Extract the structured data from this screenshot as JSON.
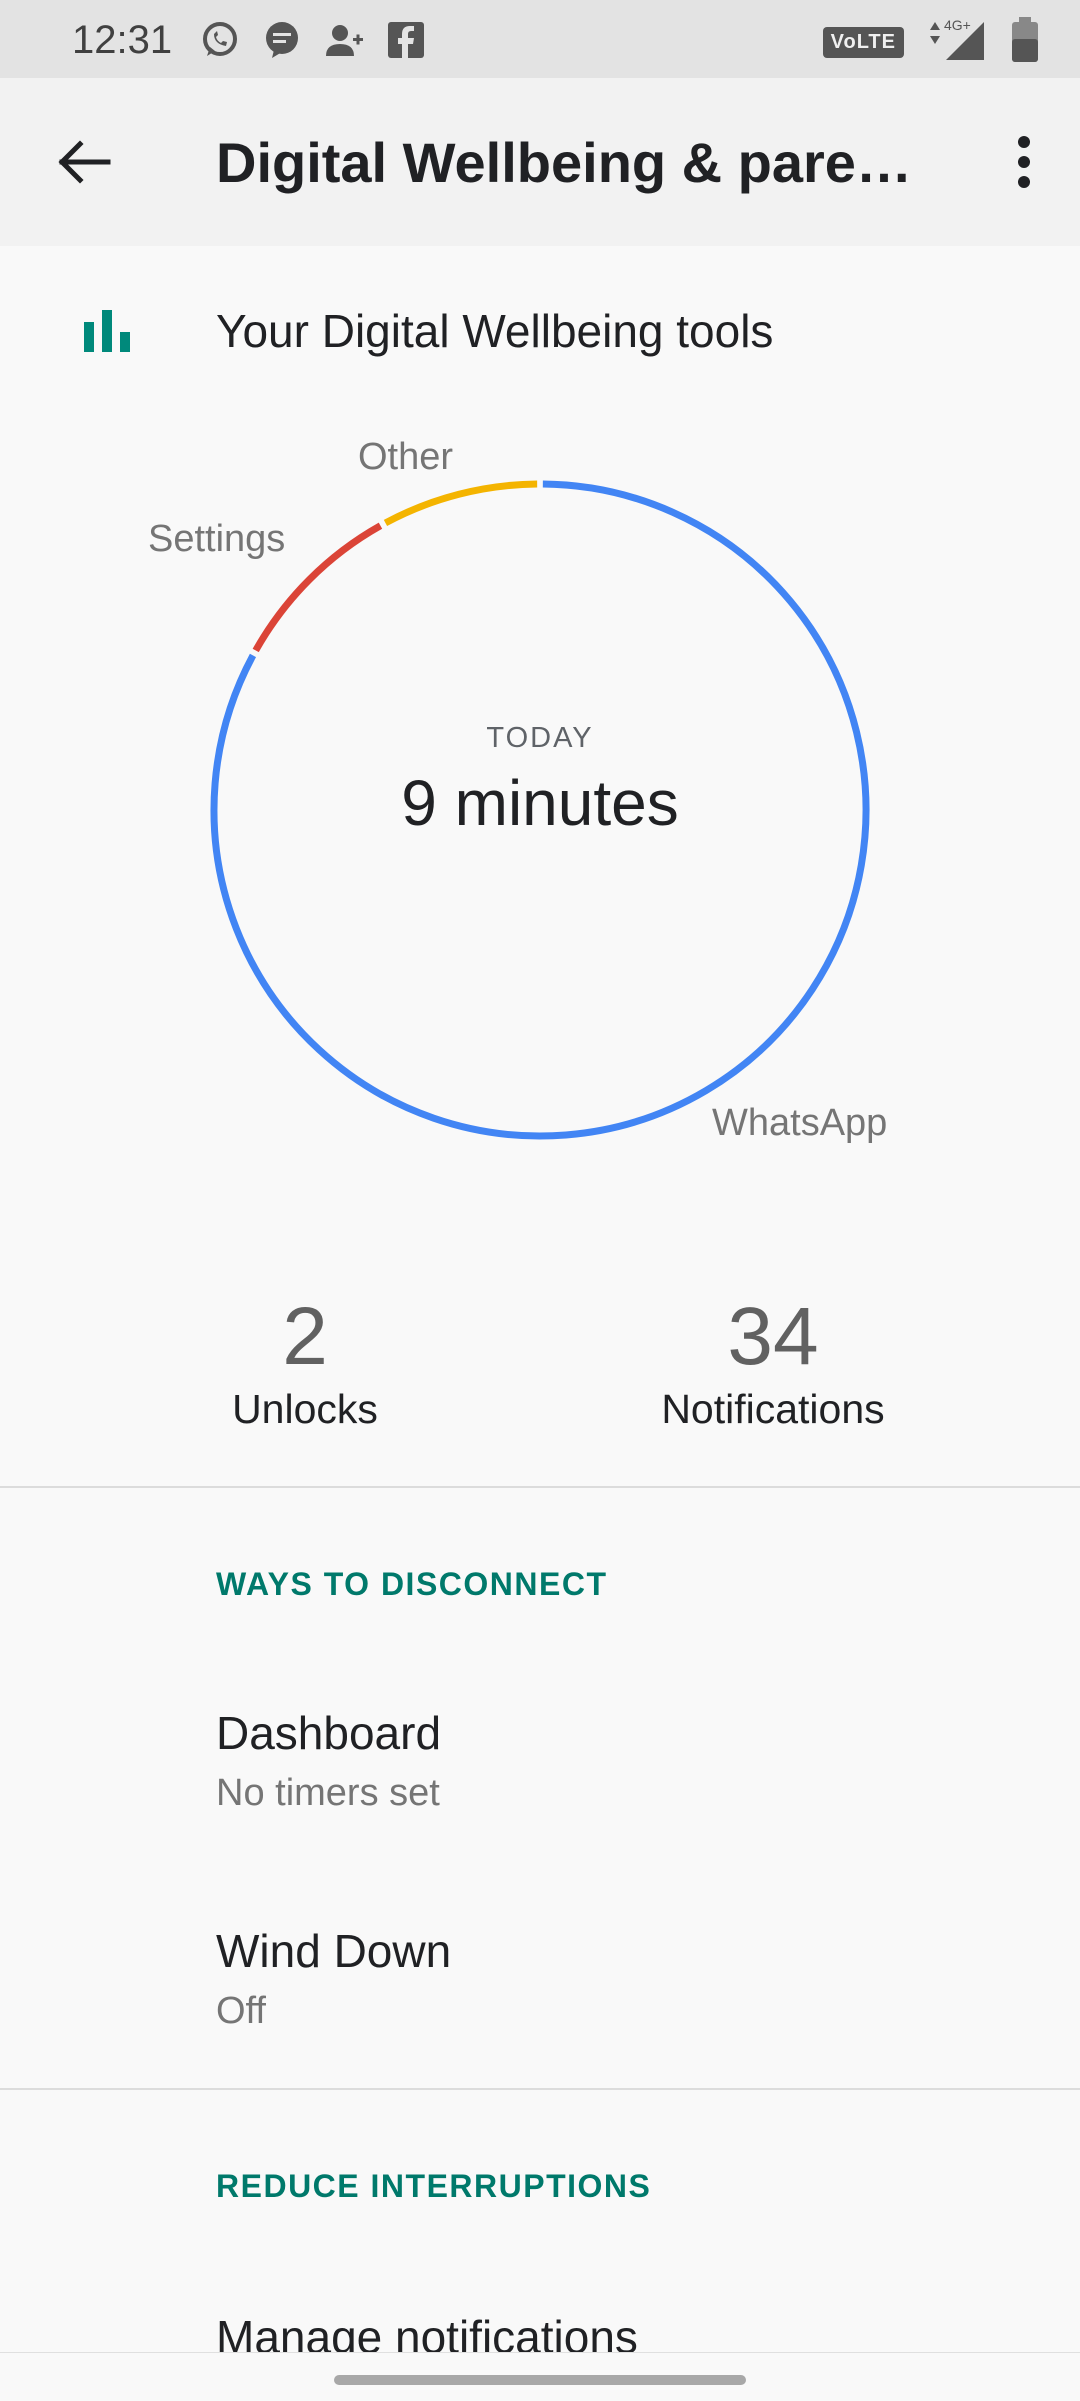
{
  "status_bar": {
    "time": "12:31",
    "left_icons": [
      "whatsapp-icon",
      "message-icon",
      "add-person-icon",
      "facebook-icon"
    ],
    "volte": "VoLTE",
    "network": "4G+"
  },
  "app_bar": {
    "title": "Digital Wellbeing & paren…"
  },
  "tools": {
    "label": "Your Digital Wellbeing tools",
    "accent": "#00897b"
  },
  "chart_data": {
    "type": "pie",
    "slices": [
      {
        "name": "WhatsApp",
        "color": "#4285f4",
        "value": 83
      },
      {
        "name": "Settings",
        "color": "#db4437",
        "value": 9
      },
      {
        "name": "Other",
        "color": "#f4b400",
        "value": 8
      }
    ],
    "center_caption": "TODAY",
    "center_value": "9 minutes"
  },
  "stats": {
    "unlocks_value": "2",
    "unlocks_label": "Unlocks",
    "notifications_value": "34",
    "notifications_label": "Notifications"
  },
  "sections": {
    "ways_header": "WAYS TO DISCONNECT",
    "dashboard_title": "Dashboard",
    "dashboard_sub": "No timers set",
    "winddown_title": "Wind Down",
    "winddown_sub": "Off",
    "reduce_header": "REDUCE INTERRUPTIONS",
    "manage_title": "Manage notifications"
  }
}
